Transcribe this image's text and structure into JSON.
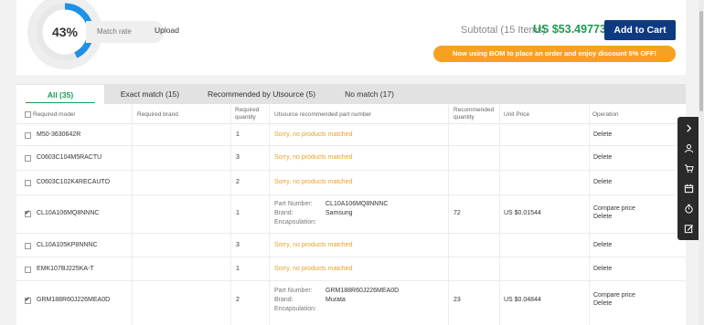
{
  "summary": {
    "match_rate_value": 43,
    "match_rate_text": "43%",
    "match_rate_label": "Match rate",
    "upload_label": "Upload",
    "subtotal_label": "Subtotal (15 Items)",
    "subtotal_amount": "US $53.49773",
    "add_to_cart_label": "Add to Cart",
    "promo_text": "Now using BOM to place an order and enjoy discount 5% OFF!"
  },
  "tabs": [
    {
      "label": "All (35)",
      "active": true
    },
    {
      "label": "Exact match (15)",
      "active": false
    },
    {
      "label": "Recommended by Utsource (5)",
      "active": false
    },
    {
      "label": "No match (17)",
      "active": false
    }
  ],
  "columns": {
    "required_model": "Required model",
    "required_brand": "Required brand",
    "required_quantity": "Required quantity",
    "recommended_part": "Utsource recommended part number",
    "recommended_quantity": "Recommended quantity",
    "unit_price": "Unit Price",
    "operation": "Operation"
  },
  "labels": {
    "part_number": "Part Number:",
    "brand": "Brand:",
    "encapsulation": "Encapsulation:",
    "compare_price": "Compare price",
    "delete": "Delete"
  },
  "rows": [
    {
      "checked": false,
      "model": "M50-3630642R",
      "quantity": "1",
      "status": "Sorry, no products matched"
    },
    {
      "checked": false,
      "model": "C0603C104M5RACTU",
      "quantity": "3",
      "status": "Sorry, no products matched"
    },
    {
      "checked": false,
      "model": "C0603C102K4RECAUTO",
      "quantity": "2",
      "status": "Sorry, no products matched"
    },
    {
      "checked": true,
      "model": "CL10A106MQ8NNNC",
      "quantity": "1",
      "part_number": "CL10A106MQ8NNNC",
      "brand": "Samsung",
      "recommended_quantity": "72",
      "unit_price": "US $0.01544"
    },
    {
      "checked": false,
      "model": "CL10A105KP8NNNC",
      "quantity": "3",
      "status": "Sorry, no products matched"
    },
    {
      "checked": false,
      "model": "EMK107BJ225KA-T",
      "quantity": "1",
      "status": "Sorry, no products matched"
    },
    {
      "checked": true,
      "model": "GRM188R60J226MEA0D",
      "quantity": "2",
      "part_number": "GRM188R60J226MEA0D",
      "brand": "Murata",
      "recommended_quantity": "23",
      "unit_price": "US $0.04844"
    }
  ],
  "sidebar_icons": [
    "chevron-right-icon",
    "user-icon",
    "cart-icon",
    "calendar-icon",
    "timer-icon",
    "edit-icon"
  ],
  "colors": {
    "accent_green": "#1a9c52",
    "primary_blue": "#0e3a82",
    "promo_orange": "#f7a121",
    "warning_text": "#e8a12a",
    "gauge_blue": "#1e90e8"
  }
}
